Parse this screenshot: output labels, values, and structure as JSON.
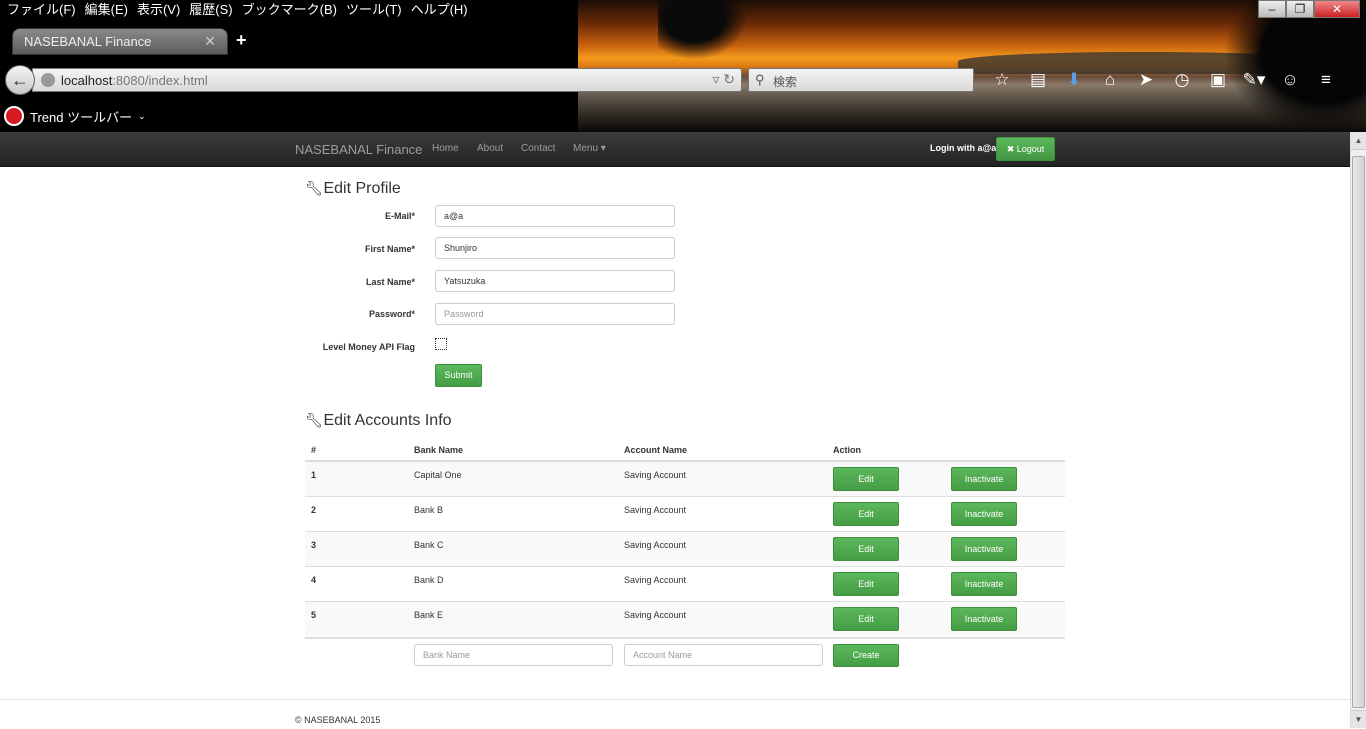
{
  "browser": {
    "menu": [
      "ファイル(F)",
      "編集(E)",
      "表示(V)",
      "履歴(S)",
      "ブックマーク(B)",
      "ツール(T)",
      "ヘルプ(H)"
    ],
    "tab_title": "NASEBANAL Finance",
    "url_host": "localhost",
    "url_rest": ":8080/index.html",
    "search_placeholder": "検索",
    "trend_label": "Trend ツールバー",
    "icons": [
      "star-icon",
      "reading-list-icon",
      "download-icon",
      "home-icon",
      "share-icon",
      "clock-icon",
      "extension-icon",
      "pen-icon",
      "smiley-icon",
      "hamburger-menu-icon"
    ]
  },
  "site": {
    "brand": "NASEBANAL Finance",
    "nav": [
      "Home",
      "About",
      "Contact",
      "Menu ▾"
    ],
    "login_text": "Login with a@a",
    "logout_label": "Logout",
    "accent": "#5cb85c"
  },
  "profile": {
    "heading": "Edit Profile",
    "email_label": "E-Mail*",
    "email_value": "a@a",
    "first_label": "First Name*",
    "first_value": "Shunjiro",
    "last_label": "Last Name*",
    "last_value": "Yatsuzuka",
    "password_label": "Password*",
    "password_placeholder": "Password",
    "flag_label": "Level Money API Flag",
    "submit_label": "Submit"
  },
  "accounts": {
    "heading": "Edit Accounts Info",
    "headers": [
      "#",
      "Bank Name",
      "Account Name",
      "Action"
    ],
    "rows": [
      {
        "num": "1",
        "bank": "Capital One",
        "account": "Saving Account"
      },
      {
        "num": "2",
        "bank": "Bank B",
        "account": "Saving Account"
      },
      {
        "num": "3",
        "bank": "Bank C",
        "account": "Saving Account"
      },
      {
        "num": "4",
        "bank": "Bank D",
        "account": "Saving Account"
      },
      {
        "num": "5",
        "bank": "Bank E",
        "account": "Saving Account"
      }
    ],
    "edit_label": "Edit",
    "inactivate_label": "Inactivate",
    "bank_placeholder": "Bank Name",
    "account_placeholder": "Account Name",
    "create_label": "Create"
  },
  "footer": "© NASEBANAL 2015"
}
